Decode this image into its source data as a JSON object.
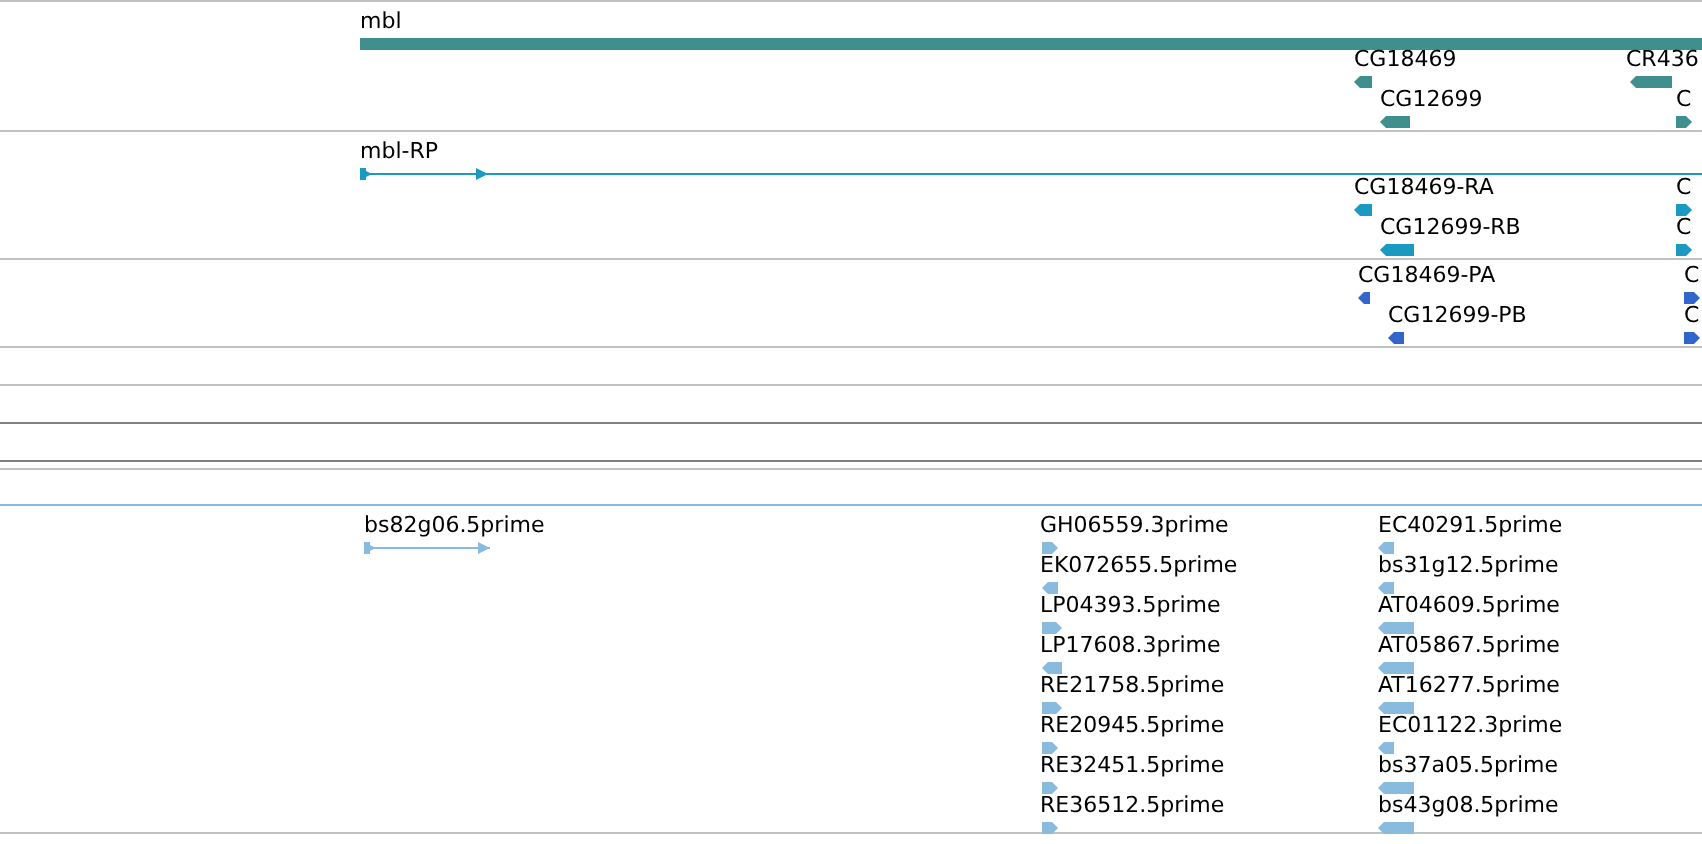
{
  "tracks": [
    {
      "kind": "gene",
      "features": [
        {
          "label": "mbl",
          "kind": "bar"
        },
        {
          "label": "CG18469",
          "reverse": true,
          "kind": "arrow"
        },
        {
          "label": "CR436",
          "reverse": true,
          "kind": "arrow"
        },
        {
          "label": "CG12699",
          "reverse": true,
          "kind": "arrow"
        },
        {
          "label": "C",
          "reverse": false,
          "kind": "arrow"
        }
      ]
    },
    {
      "kind": "transcript",
      "features": [
        {
          "label": "mbl-RP",
          "reverse": false,
          "kind": "line"
        },
        {
          "label": "CG18469-RA",
          "reverse": true,
          "kind": "arrow"
        },
        {
          "label": "C",
          "reverse": false,
          "kind": "arrow"
        },
        {
          "label": "CG12699-RB",
          "reverse": true,
          "kind": "arrow"
        },
        {
          "label": "C",
          "reverse": false,
          "kind": "arrow"
        }
      ]
    },
    {
      "kind": "protein",
      "features": [
        {
          "label": "CG18469-PA",
          "reverse": true,
          "kind": "arrow"
        },
        {
          "label": "C",
          "reverse": false,
          "kind": "arrow"
        },
        {
          "label": "CG12699-PB",
          "reverse": true,
          "kind": "arrow"
        },
        {
          "label": "C",
          "reverse": false,
          "kind": "arrow"
        }
      ]
    },
    {
      "kind": "est",
      "features": [
        {
          "label": "bs82g06.5prime",
          "reverse": false,
          "kind": "line"
        },
        {
          "label": "GH06559.3prime",
          "reverse": false,
          "kind": "arrow"
        },
        {
          "label": "EC40291.5prime",
          "reverse": true,
          "kind": "arrow"
        },
        {
          "label": "EK072655.5prime",
          "reverse": true,
          "kind": "arrow"
        },
        {
          "label": "bs31g12.5prime",
          "reverse": true,
          "kind": "arrow"
        },
        {
          "label": "LP04393.5prime",
          "reverse": false,
          "kind": "arrow"
        },
        {
          "label": "AT04609.5prime",
          "reverse": true,
          "kind": "arrow"
        },
        {
          "label": "LP17608.3prime",
          "reverse": true,
          "kind": "arrow"
        },
        {
          "label": "AT05867.5prime",
          "reverse": true,
          "kind": "arrow"
        },
        {
          "label": "RE21758.5prime",
          "reverse": false,
          "kind": "arrow"
        },
        {
          "label": "AT16277.5prime",
          "reverse": true,
          "kind": "arrow"
        },
        {
          "label": "RE20945.5prime",
          "reverse": false,
          "kind": "arrow"
        },
        {
          "label": "EC01122.3prime",
          "reverse": true,
          "kind": "arrow"
        },
        {
          "label": "RE32451.5prime",
          "reverse": false,
          "kind": "arrow"
        },
        {
          "label": "bs37a05.5prime",
          "reverse": true,
          "kind": "arrow"
        },
        {
          "label": "RE36512.5prime",
          "reverse": false,
          "kind": "arrow"
        },
        {
          "label": "bs43g08.5prime",
          "reverse": true,
          "kind": "arrow"
        }
      ]
    }
  ]
}
